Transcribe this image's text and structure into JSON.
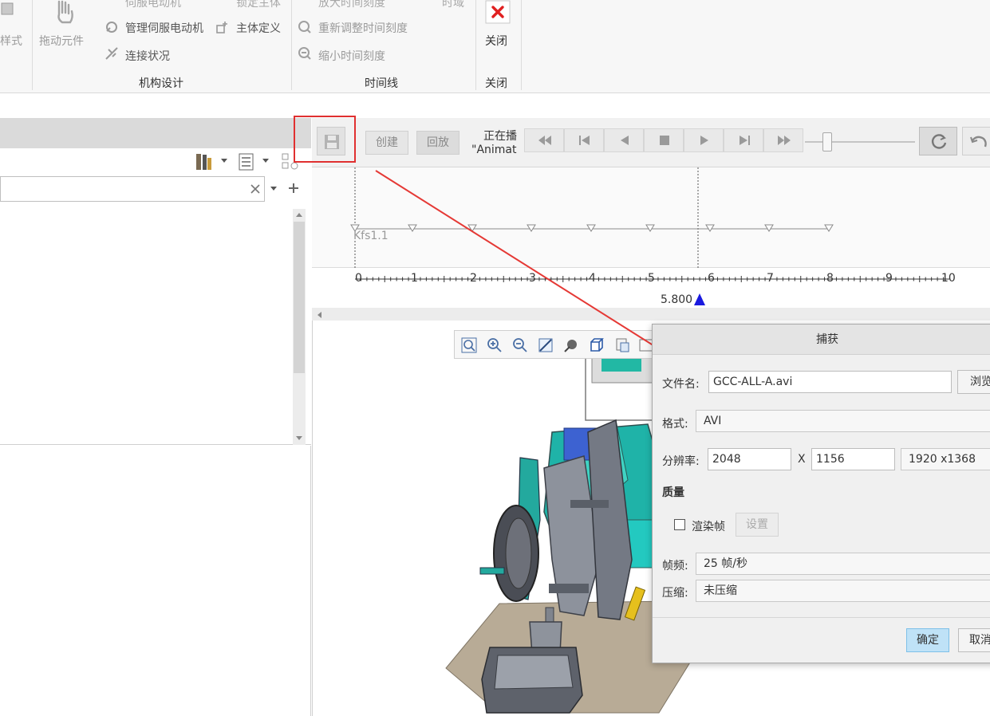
{
  "ribbon": {
    "style_label": "样式",
    "drag_components_label": "拖动元件",
    "servo_motor_label": "伺服电动机",
    "manage_servo_motor_label": "管理伺服电动机",
    "connection_status_label": "连接状况",
    "lock_body_label": "锁定主体",
    "body_definition_label": "主体定义",
    "mechanism_design_group": "机构设计",
    "zoom_in_time_label": "放大时间刻度",
    "readjust_time_label": "重新调整时间刻度",
    "zoom_out_time_label": "缩小时间刻度",
    "time_domain_label": "时域",
    "timeline_group": "时间线",
    "close_label": "关闭",
    "close_group": "关闭"
  },
  "anim_toolbar": {
    "create_label": "创建",
    "playback_label": "回放",
    "status_line1": "正在播",
    "status_line2": "\"Animat"
  },
  "timeline": {
    "keyframe_label": "Kfs1.1",
    "ticks": [
      "0",
      "1",
      "2",
      "3",
      "4",
      "5",
      "6",
      "7",
      "8",
      "9",
      "10"
    ],
    "current_time": "5.800"
  },
  "capture_dialog": {
    "title": "捕获",
    "filename_label": "文件名:",
    "filename_value": "GCC-ALL-A.avi",
    "browse_label": "浏览",
    "format_label": "格式:",
    "format_value": "AVI",
    "resolution_label": "分辨率:",
    "width_value": "2048",
    "x_label": "X",
    "height_value": "1156",
    "preset_value": "1920 x1368",
    "quality_label": "质量",
    "render_frames_label": "渲染帧",
    "settings_label": "设置",
    "fps_label": "帧频:",
    "fps_value": "25 帧/秒",
    "compression_label": "压缩:",
    "compression_value": "未压缩",
    "ok_label": "确定",
    "cancel_label": "取消"
  },
  "colors": {
    "highlight_box": "#e03030",
    "arrow": "#e53935",
    "time_marker": "#1a1adf",
    "primary_button": "#bfe2f7",
    "model_teal": "#1fb3a8",
    "model_gray": "#6a6f7a",
    "ground_plane": "#b8ab96"
  }
}
